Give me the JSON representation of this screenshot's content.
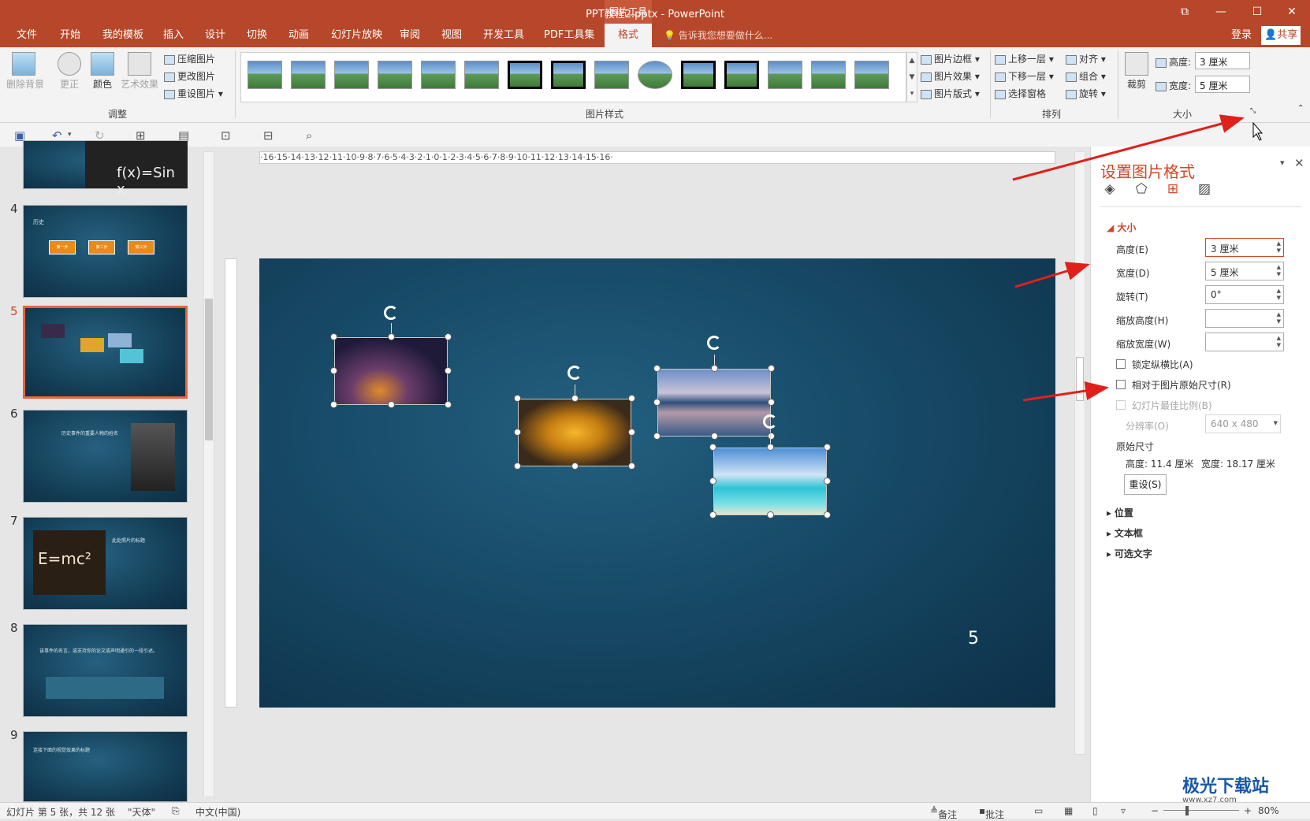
{
  "window": {
    "title": "PPT教程2.pptx - PowerPoint",
    "context_tab": "图片工具",
    "controls": [
      "⧉",
      "—",
      "☐",
      "✕"
    ]
  },
  "tabs": [
    "文件",
    "开始",
    "我的模板",
    "插入",
    "设计",
    "切换",
    "动画",
    "幻灯片放映",
    "审阅",
    "视图",
    "开发工具",
    "PDF工具集",
    "格式"
  ],
  "tell_me": "告诉我您想要做什么...",
  "account": {
    "login": "登录",
    "share": "共享"
  },
  "ribbon": {
    "adjust": {
      "remove_bg": "删除背景",
      "corrections": "更正",
      "color": "颜色",
      "artistic": "艺术效果",
      "compress": "压缩图片",
      "change": "更改图片",
      "reset": "重设图片",
      "label": "调整"
    },
    "styles": {
      "label": "图片样式",
      "border": "图片边框",
      "effects": "图片效果",
      "layout": "图片版式"
    },
    "arrange": {
      "label": "排列",
      "bring_forward": "上移一层",
      "send_backward": "下移一层",
      "selection_pane": "选择窗格",
      "align": "对齐",
      "group": "组合",
      "rotate": "旋转"
    },
    "size": {
      "label": "大小",
      "crop": "裁剪",
      "height_label": "高度:",
      "height": "3 厘米",
      "width_label": "宽度:",
      "width": "5 厘米"
    }
  },
  "thumbnails": [
    {
      "num": "",
      "slide_text": "f(x)=Sin x"
    },
    {
      "num": "4",
      "title": "历史",
      "boxes": [
        "第一步",
        "第二步",
        "第三步"
      ]
    },
    {
      "num": "5",
      "selected": true
    },
    {
      "num": "6",
      "title": "历史事件的重要人物的姓名"
    },
    {
      "num": "7",
      "formula": "E=mc²",
      "title": "此处照片的标题"
    },
    {
      "num": "8",
      "quote": "该事件的名言，或支持你的论文或声明通引的一段引述。"
    },
    {
      "num": "9",
      "title": "连接下面的视觉效果的标题"
    }
  ],
  "slide": {
    "number": "5"
  },
  "ruler": {
    "h": "·16·15·14·13·12·11·10·9·8·7·6·5·4·3·2·1·0·1·2·3·4·5·6·7·8·9·10·11·12·13·14·15·16·"
  },
  "pane": {
    "title": "设置图片格式",
    "size_section": "大小",
    "fields": [
      {
        "label": "高度(E)",
        "value": "3 厘米"
      },
      {
        "label": "宽度(D)",
        "value": "5 厘米"
      },
      {
        "label": "旋转(T)",
        "value": "0°"
      },
      {
        "label": "缩放高度(H)",
        "value": ""
      },
      {
        "label": "缩放宽度(W)",
        "value": ""
      }
    ],
    "lock_aspect": "锁定纵横比(A)",
    "relative_original": "相对于图片原始尺寸(R)",
    "best_scale": "幻灯片最佳比例(B)",
    "resolution_label": "分辨率(O)",
    "resolution": "640 x 480",
    "original_size": "原始尺寸",
    "orig_height_label": "高度:",
    "orig_height": "11.4 厘米",
    "orig_width_label": "宽度:",
    "orig_width": "18.17 厘米",
    "reset": "重设(S)",
    "sections": [
      "位置",
      "文本框",
      "可选文字"
    ]
  },
  "status": {
    "slide_info": "幻灯片 第 5 张，共 12 张",
    "theme": "\"天体\"",
    "language": "中文(中国)",
    "notes": "备注",
    "comments": "批注",
    "zoom": "80%"
  },
  "watermark": {
    "brand": "极光下载站",
    "url": "www.xz7.com"
  },
  "colors": {
    "accent": "#b7472a",
    "annotation_arrow": "#e0201a"
  }
}
